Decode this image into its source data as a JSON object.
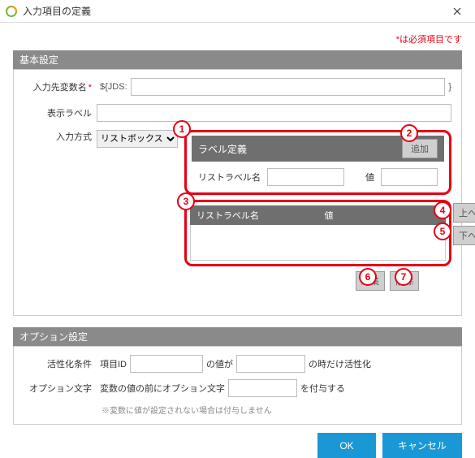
{
  "window": {
    "title": "入力項目の定義"
  },
  "required_note": "*は必須項目です",
  "basic": {
    "header": "基本設定",
    "var_label": "入力先変数名",
    "var_prefix": "${JDS:",
    "var_suffix": "}",
    "disp_label": "表示ラベル",
    "method_label": "入力方式",
    "method_value": "リストボックス",
    "label_def_header": "ラベル定義",
    "add_btn": "追加",
    "list_label_name": "リストラベル名",
    "value_label": "値",
    "grid_col1": "リストラベル名",
    "grid_col2": "値",
    "up_btn": "上へ",
    "down_btn": "下へ",
    "edit_btn": "編集",
    "delete_btn": "削除"
  },
  "option": {
    "header": "オプション設定",
    "active_label": "活性化条件",
    "item_id_label": "項目ID",
    "value_is": "の値が",
    "when_active": "の時だけ活性化",
    "optchar_label": "オプション文字",
    "optchar_text1": "変数の値の前にオプション文字",
    "optchar_text2": "を付与する",
    "hint": "※変数に値が設定されない場合は付与しません"
  },
  "footer": {
    "ok": "OK",
    "cancel": "キャンセル"
  },
  "callouts": {
    "c1": "1",
    "c2": "2",
    "c3": "3",
    "c4": "4",
    "c5": "5",
    "c6": "6",
    "c7": "7"
  }
}
